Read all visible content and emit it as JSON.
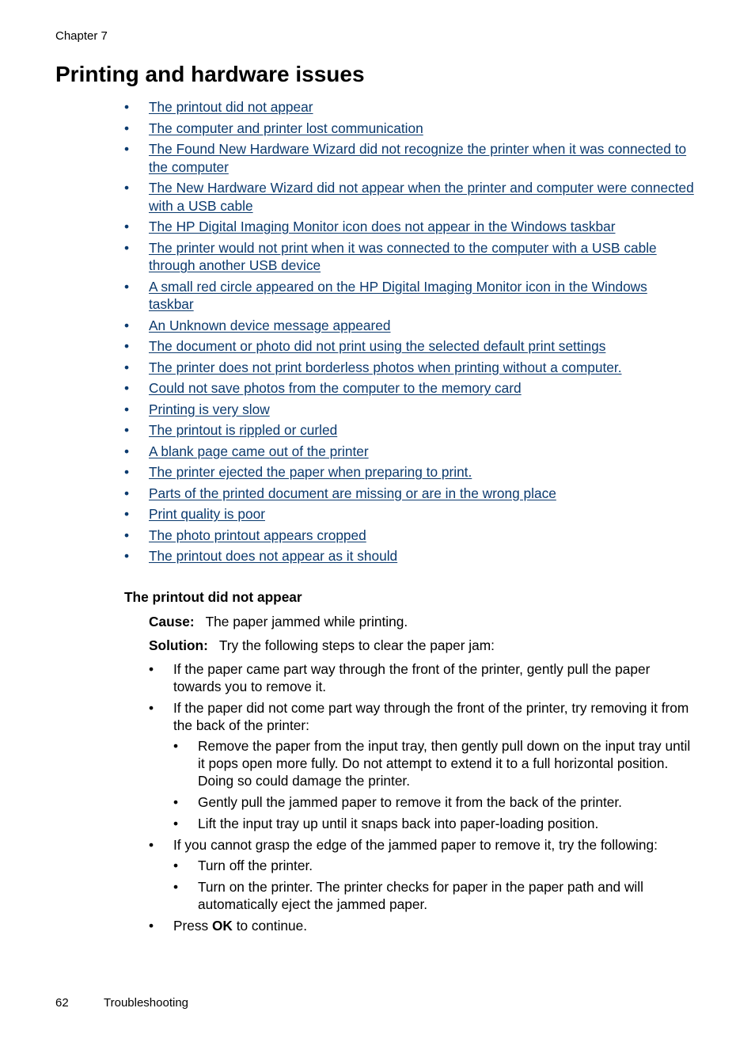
{
  "header": {
    "chapter": "Chapter 7"
  },
  "title": "Printing and hardware issues",
  "toc": [
    "The printout did not appear",
    "The computer and printer lost communication",
    "The Found New Hardware Wizard did not recognize the printer when it was connected to the computer",
    "The New Hardware Wizard did not appear when the printer and computer were connected with a USB cable",
    "The HP Digital Imaging Monitor icon does not appear in the Windows taskbar",
    "The printer would not print when it was connected to the computer with a USB cable through another USB device",
    "A small red circle appeared on the HP Digital Imaging Monitor icon in the Windows taskbar",
    "An Unknown device message appeared",
    "The document or photo did not print using the selected default print settings",
    "The printer does not print borderless photos when printing without a computer.",
    "Could not save photos from the computer to the memory card",
    "Printing is very slow",
    "The printout is rippled or curled",
    "A blank page came out of the printer",
    "The printer ejected the paper when preparing to print.",
    "Parts of the printed document are missing or are in the wrong place",
    "Print quality is poor",
    "The photo printout appears cropped",
    "The printout does not appear as it should"
  ],
  "bullet": "•",
  "section": {
    "heading": "The printout did not appear",
    "cause_label": "Cause:",
    "cause_text": "The paper jammed while printing.",
    "solution_label": "Solution:",
    "solution_text": "Try the following steps to clear the paper jam:",
    "steps": [
      {
        "text": "If the paper came part way through the front of the printer, gently pull the paper towards you to remove it."
      },
      {
        "text": "If the paper did not come part way through the front of the printer, try removing it from the back of the printer:",
        "sub": [
          "Remove the paper from the input tray, then gently pull down on the input tray until it pops open more fully. Do not attempt to extend it to a full horizontal position. Doing so could damage the printer.",
          "Gently pull the jammed paper to remove it from the back of the printer.",
          "Lift the input tray up until it snaps back into paper-loading position."
        ]
      },
      {
        "text": "If you cannot grasp the edge of the jammed paper to remove it, try the following:",
        "sub": [
          "Turn off the printer.",
          "Turn on the printer. The printer checks for paper in the paper path and will automatically eject the jammed paper."
        ]
      },
      {
        "text_before": "Press ",
        "text_bold": "OK",
        "text_after": " to continue."
      }
    ]
  },
  "footer": {
    "page_number": "62",
    "section": "Troubleshooting"
  },
  "colors": {
    "link": "#0b3a6e",
    "text": "#000000"
  }
}
